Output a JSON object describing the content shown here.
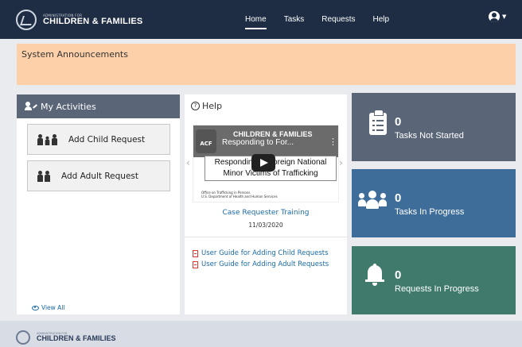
{
  "brand": {
    "small": "Administration for",
    "name": "CHILDREN & FAMILIES"
  },
  "nav": {
    "items": [
      {
        "label": "Home",
        "active": true
      },
      {
        "label": "Tasks",
        "active": false
      },
      {
        "label": "Requests",
        "active": false
      },
      {
        "label": "Help",
        "active": false
      }
    ],
    "user_icon": "user-circle-icon"
  },
  "announcements": {
    "title": "System Announcements",
    "color": "#fdd0a9"
  },
  "activities": {
    "title": "My Activities",
    "buttons": [
      {
        "label": "Add Child Request",
        "icon": "children-icon"
      },
      {
        "label": "Add Adult Request",
        "icon": "adults-icon"
      }
    ],
    "view_all": "View All"
  },
  "help": {
    "title": "Help",
    "video": {
      "logo_text": "ACF",
      "brand": "CHILDREN & FAMILIES",
      "caption": "Responding to For...",
      "slide_text": "Responding to Foreign National Minor Victims of Trafficking",
      "footer_line1": "Office on Trafficking in Persons",
      "footer_line2": "U.S. Department of Health and Human Services"
    },
    "video_title": "Case Requester Training",
    "video_date": "11/03/2020",
    "guides": [
      "User Guide for Adding Child Requests",
      "User Guide for Adding Adult Requests"
    ]
  },
  "stats": [
    {
      "value": "0",
      "label": "Tasks Not Started",
      "color": "#5a6677",
      "icon": "clipboard-list-icon"
    },
    {
      "value": "0",
      "label": "Tasks In Progress",
      "color": "#3f6d9a",
      "icon": "users-icon"
    },
    {
      "value": "0",
      "label": "Requests In Progress",
      "color": "#3f7a6c",
      "icon": "bell-icon"
    }
  ],
  "footer": {
    "small": "Administration for",
    "name": "CHILDREN & FAMILIES"
  }
}
